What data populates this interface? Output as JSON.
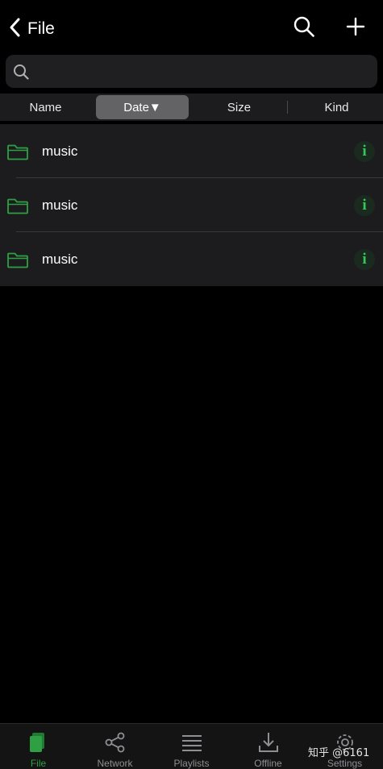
{
  "header": {
    "back_label": "File"
  },
  "search": {
    "placeholder": ""
  },
  "sort": {
    "options": [
      "Name",
      "Date▼",
      "Size",
      "Kind"
    ],
    "active": "Date▼"
  },
  "files": [
    {
      "name": "music",
      "icon": "folder-icon",
      "info": "i"
    },
    {
      "name": "music",
      "icon": "folder-icon",
      "info": "i"
    },
    {
      "name": "music",
      "icon": "folder-icon",
      "info": "i"
    }
  ],
  "tabs": [
    {
      "label": "File",
      "icon": "file-icon",
      "active": true
    },
    {
      "label": "Network",
      "icon": "share-icon",
      "active": false
    },
    {
      "label": "Playlists",
      "icon": "list-icon",
      "active": false
    },
    {
      "label": "Offline",
      "icon": "download-icon",
      "active": false
    },
    {
      "label": "Settings",
      "icon": "gear-icon",
      "active": false
    }
  ],
  "watermark": "知乎 @6161",
  "colors": {
    "accent": "#34c759",
    "background": "#000000",
    "row_background": "#1c1c1e",
    "active_segment": "#636366"
  }
}
